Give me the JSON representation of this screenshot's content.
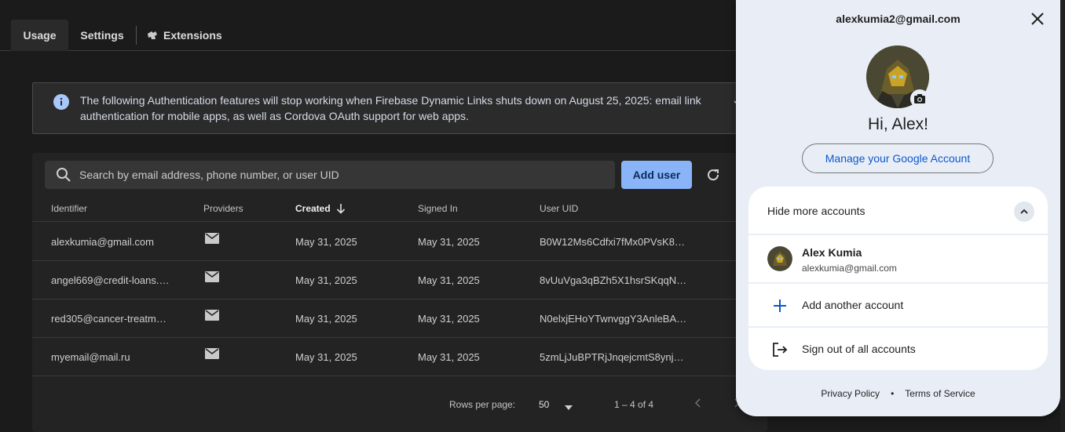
{
  "tabs": {
    "usage": "Usage",
    "settings": "Settings",
    "extensions": "Extensions"
  },
  "banner": {
    "text": "The following Authentication features will stop working when Firebase Dynamic Links shuts down on August 25, 2025: email link authentication for mobile apps, as well as Cordova OAuth support for web apps."
  },
  "search": {
    "placeholder": "Search by email address, phone number, or user UID"
  },
  "add_user_label": "Add user",
  "table": {
    "headers": {
      "identifier": "Identifier",
      "providers": "Providers",
      "created": "Created",
      "signed_in": "Signed In",
      "user_uid": "User UID"
    },
    "rows": [
      {
        "identifier": "alexkumia@gmail.com",
        "created": "May 31, 2025",
        "signed_in": "May 31, 2025",
        "uid": "B0W12Ms6Cdfxi7fMx0PVsK8…"
      },
      {
        "identifier": "angel669@credit-loans.…",
        "created": "May 31, 2025",
        "signed_in": "May 31, 2025",
        "uid": "8vUuVga3qBZh5X1hsrSKqqN…"
      },
      {
        "identifier": "red305@cancer-treatm…",
        "created": "May 31, 2025",
        "signed_in": "May 31, 2025",
        "uid": "N0elxjEHoYTwnvggY3AnleBA…"
      },
      {
        "identifier": "myemail@mail.ru",
        "created": "May 31, 2025",
        "signed_in": "May 31, 2025",
        "uid": "5zmLjJuBPTRjJnqejcmtS8ynj…"
      }
    ]
  },
  "pagination": {
    "rows_per_page_label": "Rows per page:",
    "rows_per_page_value": "50",
    "range": "1 – 4 of 4"
  },
  "account_panel": {
    "email": "alexkumia2@gmail.com",
    "greeting": "Hi, Alex!",
    "manage_label": "Manage your Google Account",
    "hide_more_label": "Hide more accounts",
    "accounts": [
      {
        "name": "Alex Kumia",
        "email": "alexkumia@gmail.com"
      }
    ],
    "add_account_label": "Add another account",
    "sign_out_label": "Sign out of all accounts",
    "privacy_label": "Privacy Policy",
    "separator": "•",
    "terms_label": "Terms of Service"
  },
  "colors": {
    "accent": "#8ab4f8",
    "panel_bg": "#e9eef6",
    "link_blue": "#0b57d0",
    "page_bg": "#1b1b1b"
  }
}
